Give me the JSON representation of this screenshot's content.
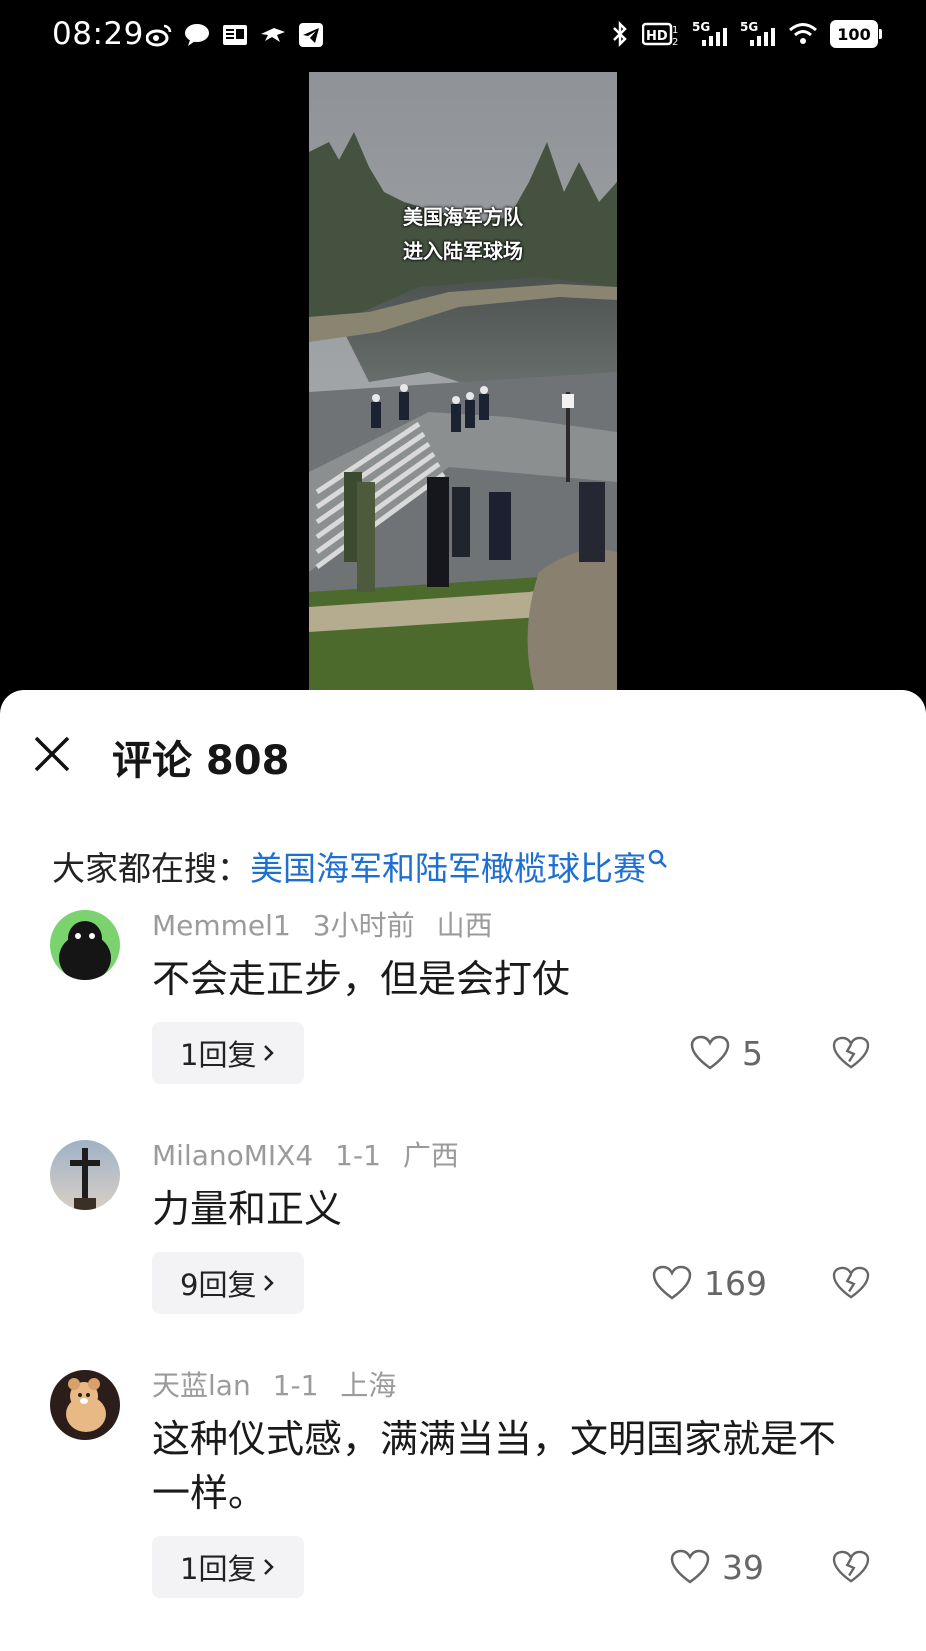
{
  "status_bar": {
    "time": "08:29",
    "app_icons": [
      "weibo-icon",
      "chat-bubble-icon",
      "toutiao-icon",
      "bird-icon",
      "telegram-icon"
    ],
    "right_icons": [
      "bluetooth-icon",
      "hd-icon",
      "signal-5g-icon",
      "signal-5g-icon",
      "wifi-icon"
    ],
    "battery": "100"
  },
  "video": {
    "caption_line1": "美国海军方队",
    "caption_line2": "进入陆军球场"
  },
  "comments_panel": {
    "title": "评论 808",
    "search_prefix": "大家都在搜：",
    "search_link": "美国海军和陆军橄榄球比赛",
    "comments": [
      {
        "user": "Memmel1",
        "time": "3小时前",
        "location": "山西",
        "text": "不会走正步，但是会打仗",
        "reply_label": "1回复",
        "likes": "5",
        "avatar": "penguin-avatar"
      },
      {
        "user": "MilanoMIX4",
        "time": "1-1",
        "location": "广西",
        "text": "力量和正义",
        "reply_label": "9回复",
        "likes": "169",
        "avatar": "cross-avatar"
      },
      {
        "user": "天蓝lan",
        "time": "1-1",
        "location": "上海",
        "text": "这种仪式感，满满当当，文明国家就是不一样。",
        "reply_label": "1回复",
        "likes": "39",
        "avatar": "plush-bear-avatar"
      }
    ]
  },
  "colors": {
    "link": "#1f6fd1",
    "meta_gray": "#9b9b9b",
    "reply_bg": "#f3f3f5"
  }
}
